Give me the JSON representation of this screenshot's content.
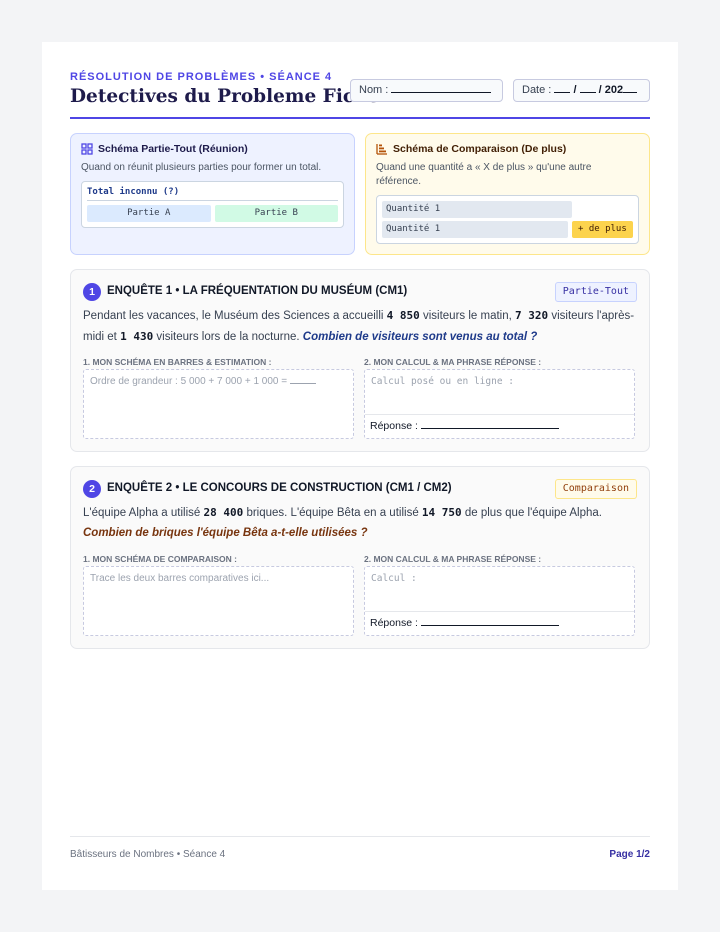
{
  "header": {
    "kicker": "RÉSOLUTION DE PROBLÈMES • SÉANCE 4",
    "title": "Detectives du Probleme Fiche",
    "name_label": "Nom :",
    "date_label": "Date :",
    "date_sep1": "/",
    "date_sep2": "/ 202"
  },
  "schemas": {
    "part_whole": {
      "icon": "grid-icon",
      "title": "Schéma Partie-Tout (Réunion)",
      "description": "Quand on réunit plusieurs parties pour former un total.",
      "total": "Total inconnu (?)",
      "part_a": "Partie A",
      "part_b": "Partie B"
    },
    "comparison": {
      "icon": "bar-chart-icon",
      "title": "Schéma de Comparaison (De plus)",
      "description": "Quand une quantité a « X de plus » qu'une autre référence.",
      "row1": "Quantité 1",
      "row2": "Quantité 1",
      "plus": "+ de plus"
    }
  },
  "enquetes": [
    {
      "number": "1",
      "title": "ENQUÊTE 1 • LA FRÉQUENTATION DU MUSÉUM (CM1)",
      "badge": "Partie-Tout",
      "text_1": "Pendant les vacances, le Muséum des Sciences a accueilli",
      "value_1": "4 850",
      "text_2": "visiteurs le matin,",
      "value_2": "7 320",
      "text_3": "visiteurs l'après-midi et",
      "value_3": "1 430",
      "text_4": "visiteurs lors de la nocturne.",
      "question": "Combien de visiteurs sont venus au total ?",
      "left_label": "1. MON SCHÉMA EN BARRES & ESTIMATION :",
      "left_placeholder": "Ordre de grandeur : 5 000 + 7 000 + 1 000 =",
      "right_label": "2. MON CALCUL & MA PHRASE RÉPONSE :",
      "right_placeholder": "Calcul posé ou en ligne :",
      "answer_label": "Réponse :"
    },
    {
      "number": "2",
      "title": "ENQUÊTE 2 • LE CONCOURS DE CONSTRUCTION (CM1 / CM2)",
      "badge": "Comparaison",
      "text_1": "L'équipe Alpha a utilisé",
      "value_1": "28 400",
      "text_2": "briques. L'équipe Bêta en a utilisé",
      "value_2": "14 750",
      "text_3": "de plus que l'équipe Alpha.",
      "question": "Combien de briques l'équipe Bêta a-t-elle utilisées ?",
      "left_label": "1. MON SCHÉMA DE COMPARAISON :",
      "left_placeholder": "Trace les deux barres comparatives ici...",
      "right_label": "2. MON CALCUL & MA PHRASE RÉPONSE :",
      "right_placeholder": "Calcul :",
      "answer_label": "Réponse :"
    }
  ],
  "footer": {
    "left": "Bâtisseurs de Nombres • Séance 4",
    "right": "Page 1/2"
  },
  "colors": {
    "accent": "#4f46e5",
    "part_whole_bg": "#eef2ff",
    "comparison_bg": "#fffbeb",
    "plus_bar": "#fcd34d"
  }
}
